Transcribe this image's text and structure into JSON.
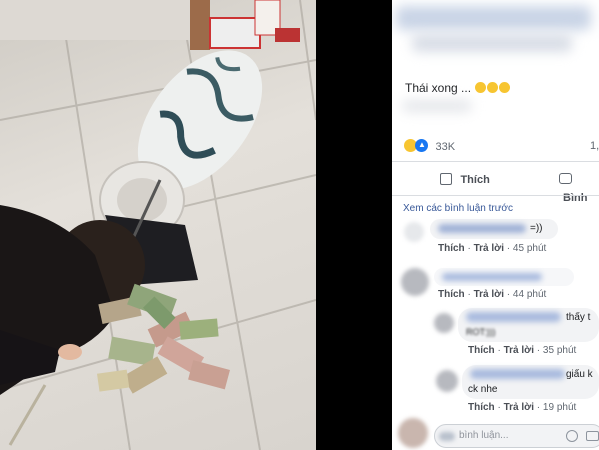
{
  "post": {
    "caption": "Thái xong ...",
    "reaction_count": "33K",
    "share_count_partial": "1,"
  },
  "actions": {
    "like_label": "Thích",
    "comment_label": "Bình"
  },
  "comments": {
    "view_previous": "Xem các bình luận trước",
    "items": [
      {
        "text": "=))",
        "like": "Thích",
        "reply": "Trả lời",
        "time": "45 phút"
      },
      {
        "text": "",
        "like": "Thích",
        "reply": "Trả lời",
        "time": "44 phút"
      },
      {
        "text": "thấy t",
        "text2": "ROT:)))",
        "like": "Thích",
        "reply": "Trả lời",
        "time": "35 phút"
      },
      {
        "text": "giấu k",
        "text2": "ck nhe",
        "like": "Thích",
        "reply": "Trả lời",
        "time": "19 phút"
      }
    ],
    "input_placeholder": "bình luận..."
  },
  "colors": {
    "link_blue": "#385898",
    "like_blue": "#1877f2",
    "comment_bg": "#f2f3f5"
  }
}
